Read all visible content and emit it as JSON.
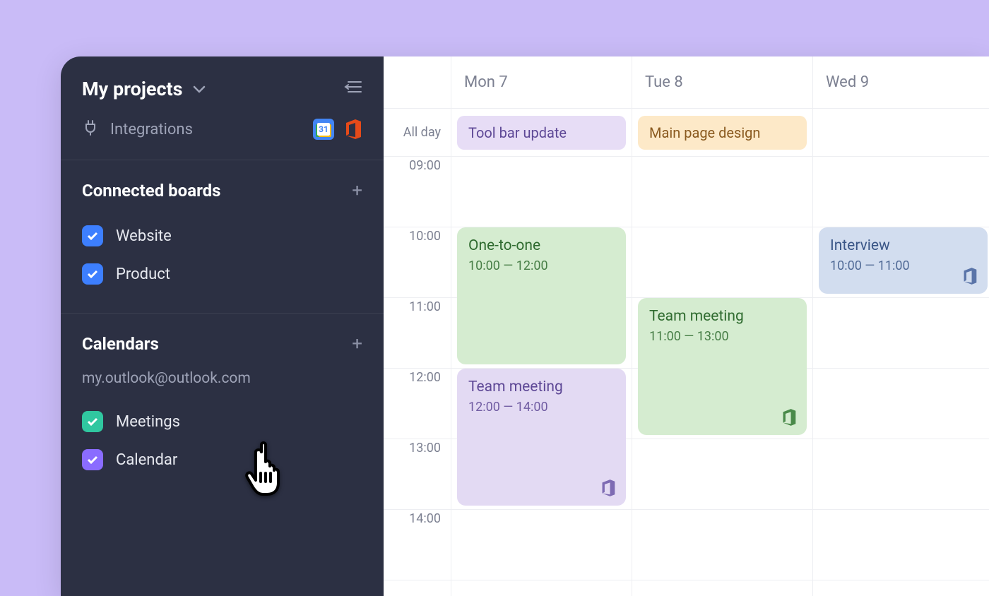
{
  "sidebar": {
    "title": "My projects",
    "integrations_label": "Integrations",
    "sections": {
      "boards": {
        "title": "Connected boards",
        "items": [
          {
            "label": "Website",
            "color": "blue"
          },
          {
            "label": "Product",
            "color": "blue"
          }
        ]
      },
      "calendars": {
        "title": "Calendars",
        "account": "my.outlook@outlook.com",
        "items": [
          {
            "label": "Meetings",
            "color": "green"
          },
          {
            "label": "Calendar",
            "color": "purple"
          }
        ]
      }
    }
  },
  "calendar": {
    "allday_label": "All day",
    "time_labels": [
      "09:00",
      "10:00",
      "11:00",
      "12:00",
      "13:00",
      "14:00"
    ],
    "days": [
      {
        "header": "Mon 7",
        "allday": {
          "title": "Tool bar update",
          "theme": "lav"
        },
        "events": [
          {
            "title": "One-to-one",
            "time": "10:00 — 12:00",
            "start": "10:00",
            "end": "12:00",
            "theme": "green"
          },
          {
            "title": "Team meeting",
            "time": "12:00 — 14:00",
            "start": "12:00",
            "end": "14:00",
            "theme": "lav",
            "icon": "office",
            "icon_color": "#7e6bb3"
          }
        ]
      },
      {
        "header": "Tue 8",
        "allday": {
          "title": "Main page design",
          "theme": "orange"
        },
        "events": [
          {
            "title": "Team meeting",
            "time": "11:00 — 13:00",
            "start": "11:00",
            "end": "13:00",
            "theme": "green",
            "icon": "office",
            "icon_color": "#4a8a4a"
          }
        ]
      },
      {
        "header": "Wed 9",
        "allday": null,
        "events": [
          {
            "title": "Interview",
            "time": "10:00 — 11:00",
            "start": "10:00",
            "end": "11:00",
            "theme": "blue",
            "icon": "office",
            "icon_color": "#5a74a8"
          }
        ]
      }
    ]
  }
}
